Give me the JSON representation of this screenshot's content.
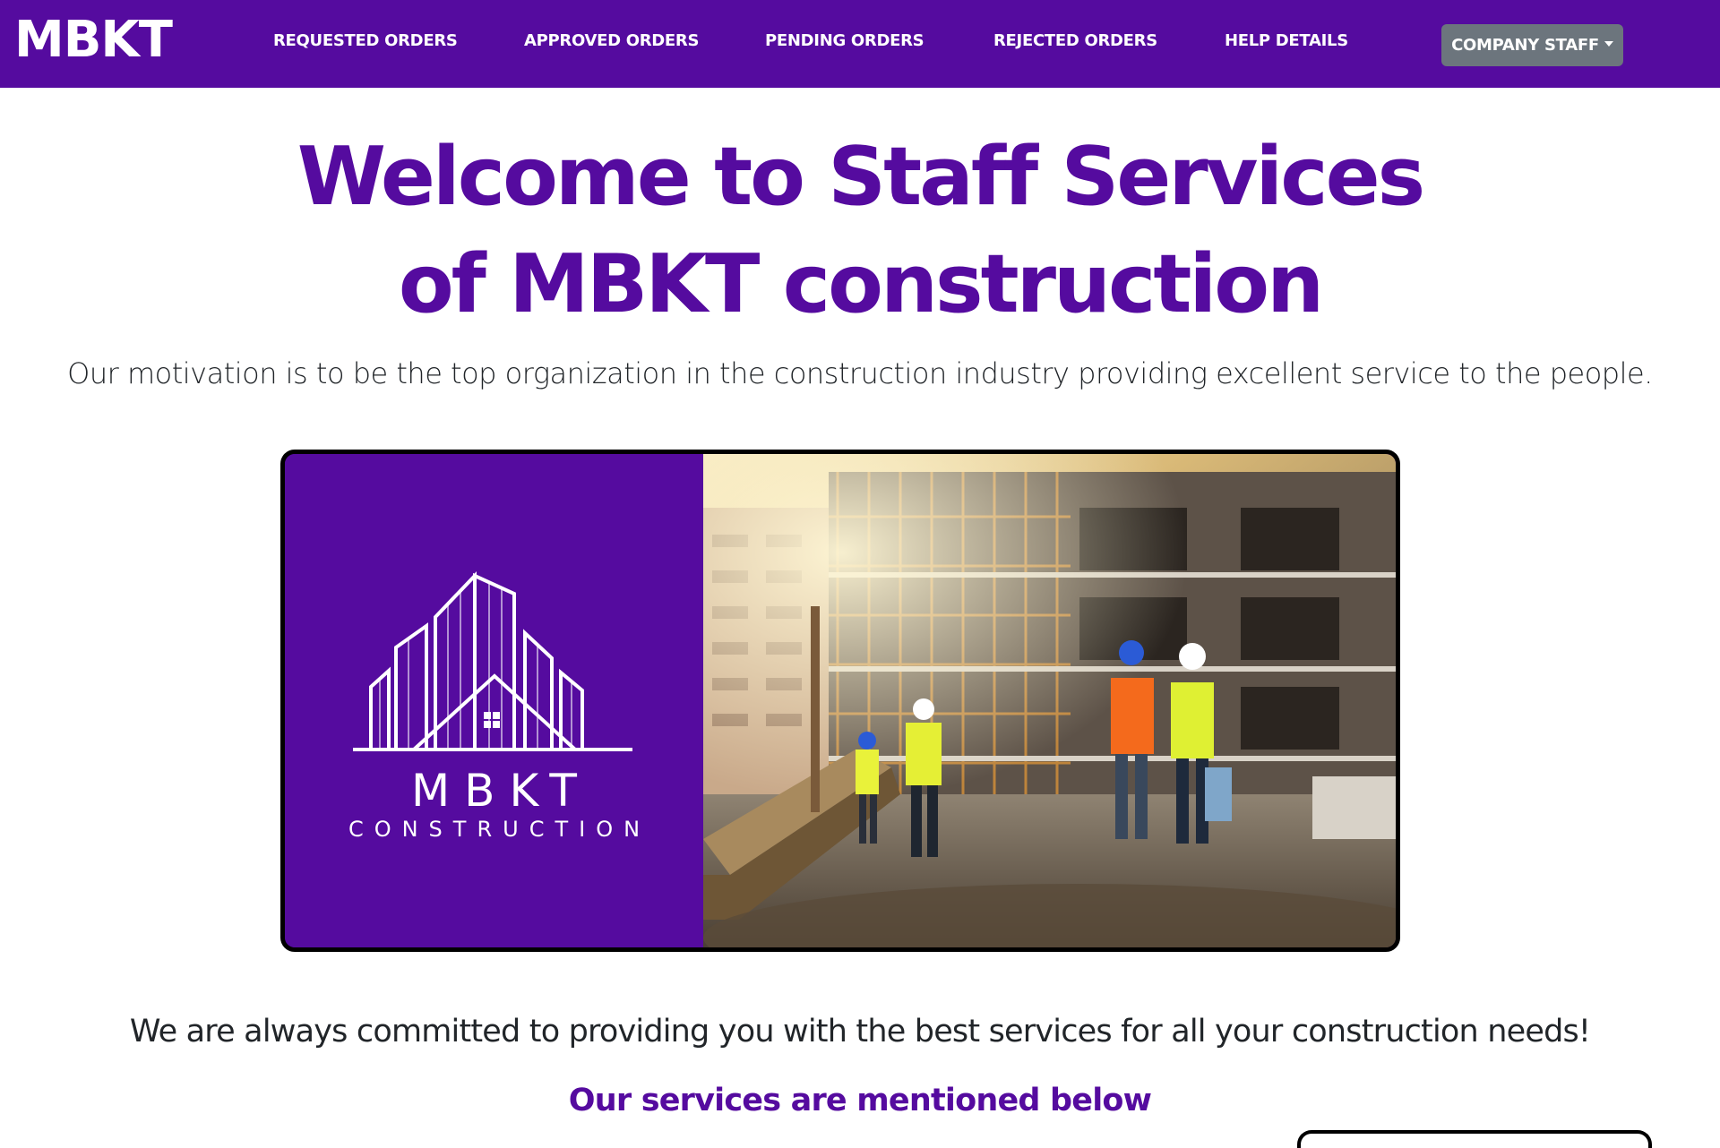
{
  "navbar": {
    "brand": "MBKT",
    "links": [
      {
        "label": "REQUESTED ORDERS"
      },
      {
        "label": "APPROVED ORDERS"
      },
      {
        "label": "PENDING ORDERS"
      },
      {
        "label": "REJECTED ORDERS"
      },
      {
        "label": "HELP DETAILS"
      }
    ],
    "staff_dropdown": {
      "label": "COMPANY STAFF",
      "icon": "caret-down-icon"
    }
  },
  "hero": {
    "title_line1": "Welcome to Staff Services",
    "title_line2": "of MBKT construction",
    "motivation": "Our motivation is to be the top organization in the construction industry providing excellent service to the people."
  },
  "banner": {
    "logo_word": "MBKT",
    "logo_sub": "CONSTRUCTION",
    "photo": "construction-site-photo"
  },
  "content": {
    "commitment": "We are always committed to providing you with the best services for all your construction needs!",
    "services_heading": "Our services are mentioned below"
  },
  "colors": {
    "brand_purple": "#550b9f",
    "dropdown_gray": "#6c757d",
    "text_dark": "#212529"
  }
}
